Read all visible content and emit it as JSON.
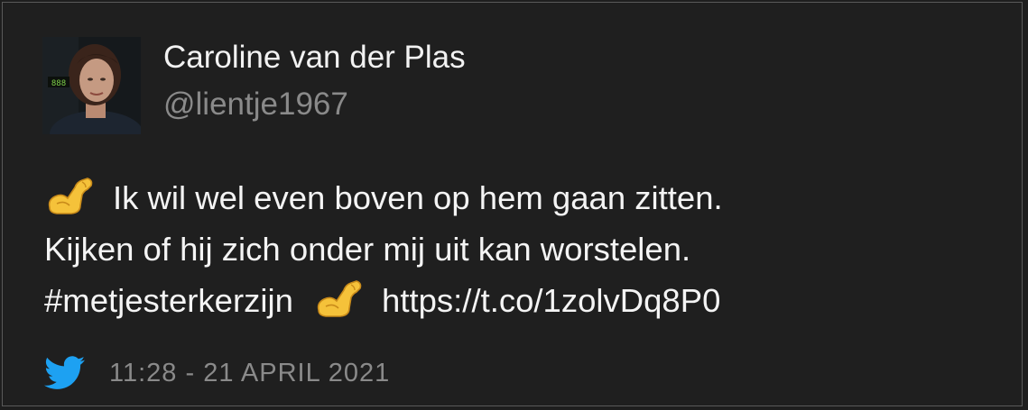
{
  "author": {
    "display_name": "Caroline van der Plas",
    "handle": "@lientje1967",
    "avatar_badge": "888"
  },
  "tweet": {
    "line1_text": "Ik wil wel even boven op hem gaan zitten.",
    "line2_text": "Kijken of hij zich onder mij uit kan worstelen.",
    "hashtag": "#metjesterkerzijn",
    "link": "https://t.co/1zolvDq8P0",
    "emoji": "flexed-biceps"
  },
  "footer": {
    "timestamp": "11:28 - 21 APRIL 2021",
    "icon": "twitter-bird-icon"
  },
  "colors": {
    "background": "#1f1f1f",
    "border": "#5a5a5a",
    "text_primary": "#f4f4f4",
    "text_secondary": "#8a8a8a",
    "twitter_blue": "#1da1f2"
  }
}
